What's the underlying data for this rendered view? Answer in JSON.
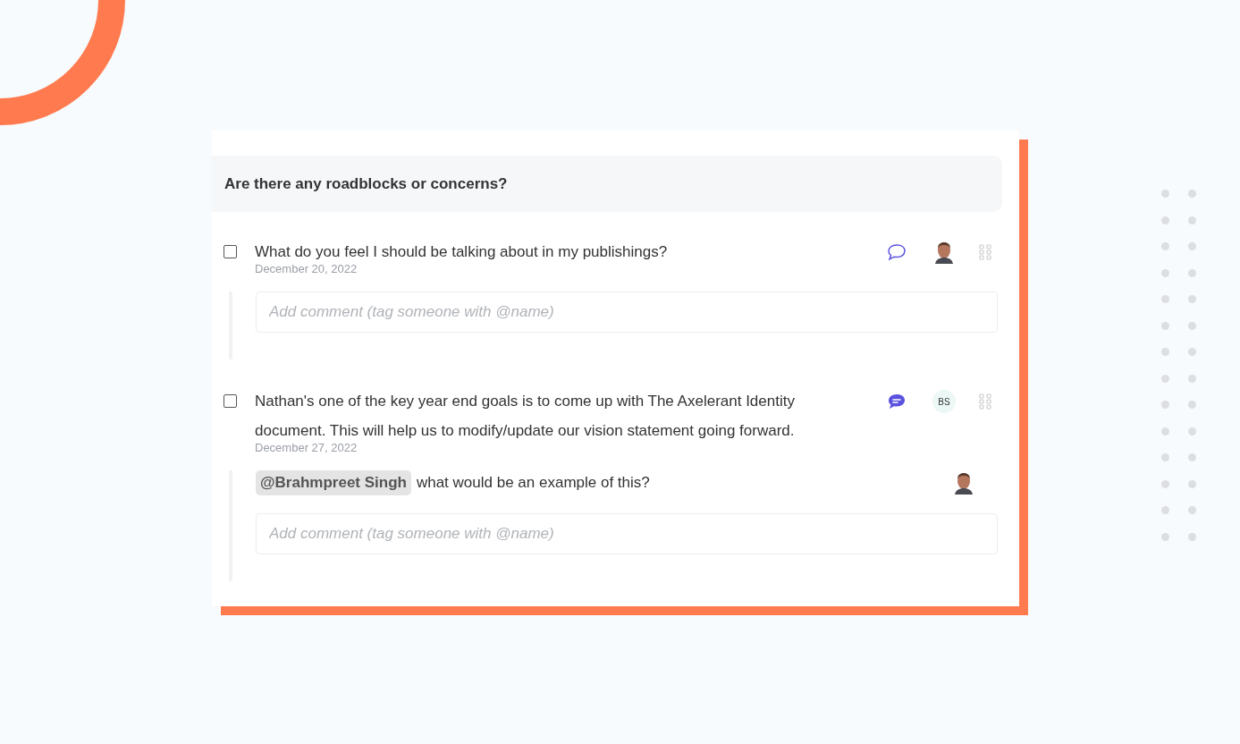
{
  "section": {
    "title": "Are there any roadblocks or concerns?"
  },
  "items": [
    {
      "checked": false,
      "text": "What do you feel I should be talking about in my publishings?",
      "date": "December 20, 2022",
      "has_comments": false,
      "assignee": {
        "kind": "photo"
      },
      "comment_placeholder": "Add comment (tag someone with @name)"
    },
    {
      "checked": false,
      "text": "Nathan's one of the key year end goals is to come up with The Axelerant Identity document. This will help us to modify/update our vision statement going forward.",
      "date": "December 27, 2022",
      "has_comments": true,
      "assignee": {
        "kind": "initials",
        "initials": "BS"
      },
      "comments": [
        {
          "mention": "@Brahmpreet Singh",
          "text": "what would be an example of this?",
          "author": {
            "kind": "photo"
          }
        }
      ],
      "comment_placeholder": "Add comment (tag someone with @name)"
    }
  ]
}
